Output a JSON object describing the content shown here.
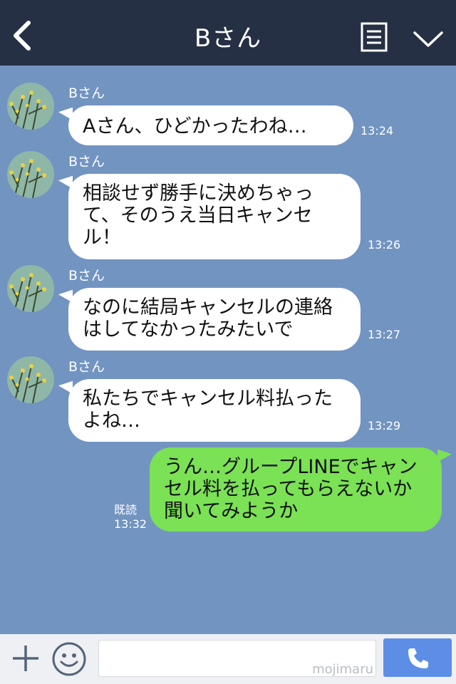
{
  "header": {
    "title": "Bさん",
    "back_icon": "chevron-left-icon",
    "menu_icon": "list-icon",
    "dropdown_icon": "chevron-down-icon"
  },
  "messages": [
    {
      "sender": "Bさん",
      "text": "Aさん、ひどかったわね…",
      "time": "13:24"
    },
    {
      "sender": "Bさん",
      "text": "相談せず勝手に決めちゃって、そのうえ当日キャンセル！",
      "time": "13:26"
    },
    {
      "sender": "Bさん",
      "text": "なのに結局キャンセルの連絡はしてなかったみたいで",
      "time": "13:27"
    },
    {
      "sender": "Bさん",
      "text": "私たちでキャンセル料払ったよね…",
      "time": "13:29"
    },
    {
      "sender": "me",
      "text": "うん…グループLINEでキャンセル料を払ってもらえないか聞いてみようか",
      "read": "既読",
      "time": "13:32"
    }
  ],
  "footer": {
    "plus_icon": "plus-icon",
    "emoji_icon": "smiley-icon",
    "input_value": "",
    "watermark": "mojimaru",
    "call_icon": "phone-icon"
  },
  "colors": {
    "header_bg": "#263044",
    "chat_bg": "#7294c1",
    "incoming_bubble": "#ffffff",
    "outgoing_bubble": "#7be155",
    "call_button": "#5c8ee6"
  }
}
